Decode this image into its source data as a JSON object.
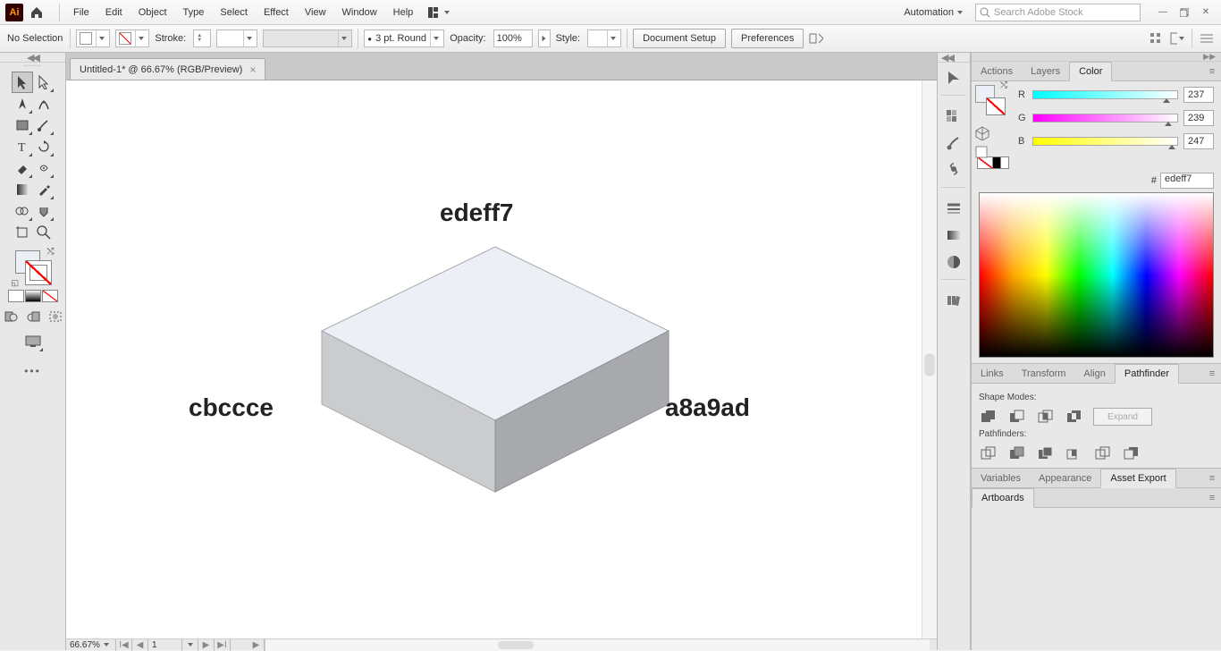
{
  "app": {
    "logo": "Ai"
  },
  "menu": [
    "File",
    "Edit",
    "Object",
    "Type",
    "Select",
    "Effect",
    "View",
    "Window",
    "Help"
  ],
  "workspace": "Automation",
  "search_placeholder": "Search Adobe Stock",
  "control": {
    "selection_label": "No Selection",
    "stroke_label": "Stroke:",
    "brush_label": "3 pt. Round",
    "opacity_label": "Opacity:",
    "opacity_value": "100%",
    "style_label": "Style:",
    "btn_docsetup": "Document Setup",
    "btn_prefs": "Preferences"
  },
  "doc": {
    "tab_title": "Untitled-1* @ 66.67% (RGB/Preview)",
    "zoom": "66.67%",
    "artboard_num": "1",
    "tool_name": "Selection"
  },
  "canvas": {
    "label_top": "edeff7",
    "label_left": "cbccce",
    "label_right": "a8a9ad"
  },
  "panels": {
    "color_tabs": [
      "Actions",
      "Layers",
      "Color"
    ],
    "rgb": {
      "r_label": "R",
      "g_label": "G",
      "b_label": "B",
      "r": "237",
      "g": "239",
      "b": "247",
      "hex_label": "#",
      "hex": "edeff7"
    },
    "links_tabs": [
      "Links",
      "Transform",
      "Align",
      "Pathfinder"
    ],
    "pathfinder": {
      "shape_modes": "Shape Modes:",
      "pathfinders": "Pathfinders:",
      "expand": "Expand"
    },
    "asset_tabs": [
      "Variables",
      "Appearance",
      "Asset Export"
    ],
    "artboards_tab": "Artboards"
  }
}
